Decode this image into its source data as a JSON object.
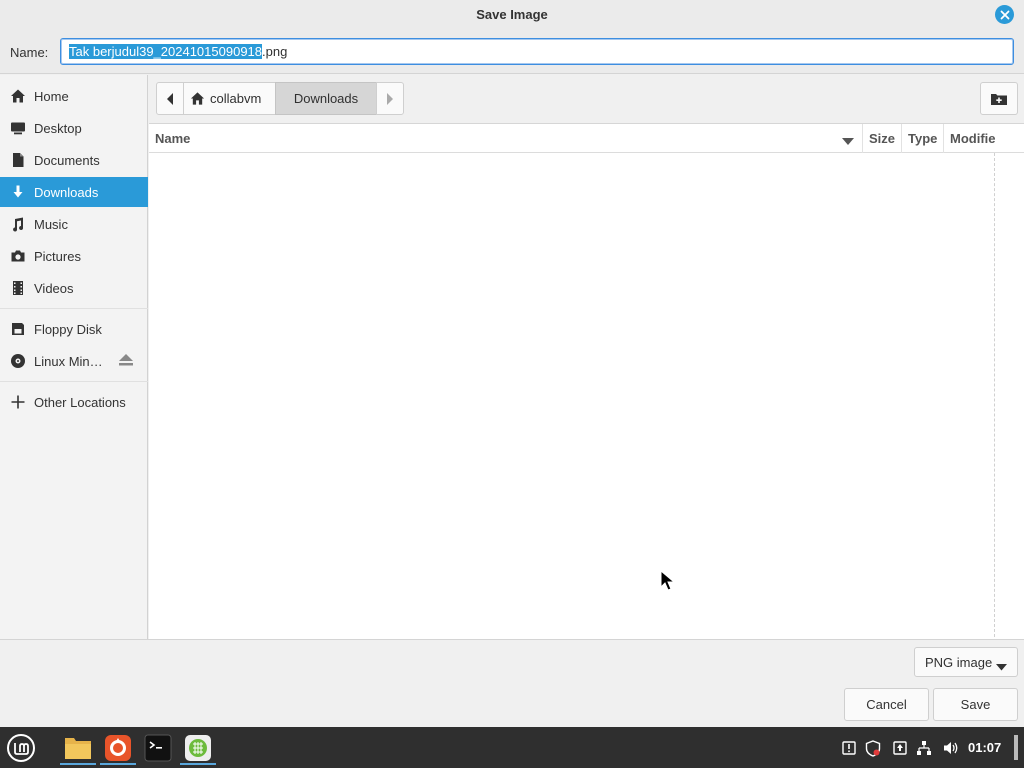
{
  "window": {
    "title": "Save Image"
  },
  "name_row": {
    "label": "Name:",
    "filename_selected": "Tak berjudul39_20241015090918",
    "filename_ext": ".png"
  },
  "sidebar": {
    "items": [
      {
        "label": "Home",
        "icon": "home-icon"
      },
      {
        "label": "Desktop",
        "icon": "desktop-icon"
      },
      {
        "label": "Documents",
        "icon": "documents-icon"
      },
      {
        "label": "Downloads",
        "icon": "download-icon",
        "active": true
      },
      {
        "label": "Music",
        "icon": "music-icon"
      },
      {
        "label": "Pictures",
        "icon": "camera-icon"
      },
      {
        "label": "Videos",
        "icon": "film-icon"
      },
      {
        "label": "Floppy Disk",
        "icon": "floppy-icon"
      },
      {
        "label": "Linux Min…",
        "icon": "disc-icon"
      },
      {
        "label": "Other Locations",
        "icon": "plus-icon"
      }
    ]
  },
  "pathbar": {
    "home_label": "collabvm",
    "current_label": "Downloads"
  },
  "filelist": {
    "columns": [
      "Name",
      "Size",
      "Type",
      "Modifie"
    ]
  },
  "filter": {
    "selected": "PNG image"
  },
  "actions": {
    "cancel": "Cancel",
    "save": "Save"
  },
  "taskbar": {
    "clock": "01:07"
  },
  "colors": {
    "accent": "#2a9ad8",
    "taskbar": "#2f2f2f"
  }
}
